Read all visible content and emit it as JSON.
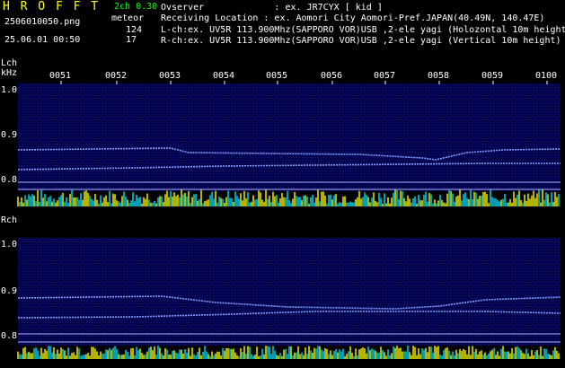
{
  "header": {
    "logo": "H R O F F T",
    "version": "2ch 0.30",
    "filename": "2506010050.png",
    "datetime": "25.06.01 00:50",
    "meteor_label": "meteor",
    "lch_count": "124",
    "rch_count": "17",
    "observer": "Ovserver             : ex. JR7CYX [ kid ]",
    "location": "Receiving Location : ex. Aomori City Aomori-Pref.JAPAN(40.49N, 140.47E)",
    "lch_desc": "L-ch:ex. UV5R 113.900Mhz(SAPPORO VOR)USB ,2-ele yagi (Holozontal 10m height)",
    "rch_desc": "R-ch:ex. UV5R 113.900Mhz(SAPPORO VOR)USB ,2-ele yagi (Vertical 10m height)"
  },
  "time_ticks": [
    "0051",
    "0052",
    "0053",
    "0054",
    "0055",
    "0056",
    "0057",
    "0058",
    "0059",
    "0100"
  ],
  "lch": {
    "label": "Lch",
    "unit": "kHz",
    "ticks": [
      "1.0",
      "0.9",
      "0.8"
    ]
  },
  "rch": {
    "label": "Rch",
    "ticks": [
      "1.0",
      "0.9",
      "0.8"
    ]
  },
  "colors": {
    "background": "#000000",
    "panel": "#02024a",
    "trace": "#7f9fff",
    "signal_yellow": "#ffff00",
    "signal_cyan": "#00e5ff",
    "logo": "#ffff00",
    "version": "#00ff00"
  }
}
